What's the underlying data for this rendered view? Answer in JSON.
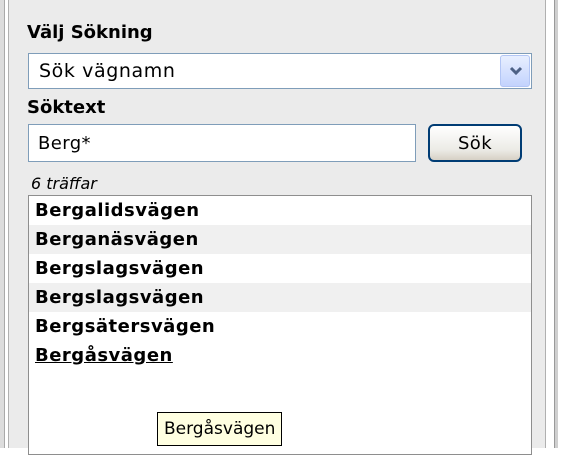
{
  "search_panel": {
    "search_type_label": "Välj Sökning",
    "search_type_selected": "Sök vägnamn",
    "search_text_label": "Söktext",
    "search_text_value": "Berg*",
    "search_button_label": "Sök",
    "result_count": "6 träffar",
    "results": [
      {
        "label": "Bergalidsvägen"
      },
      {
        "label": "Berganäsvägen"
      },
      {
        "label": "Bergslagsvägen"
      },
      {
        "label": "Bergslagsvägen"
      },
      {
        "label": "Bergsätersvägen"
      },
      {
        "label": "Bergåsvägen"
      }
    ],
    "hovered_index": 5,
    "tooltip_text": "Bergåsvägen"
  },
  "colors": {
    "input_border": "#7f9db9",
    "button_border": "#003c74",
    "dropdown_button": "#c3d3fd",
    "panel_background": "#ebebeb",
    "tooltip_background": "#ffffe1"
  },
  "icons": {
    "dropdown": "chevron-down-icon"
  }
}
